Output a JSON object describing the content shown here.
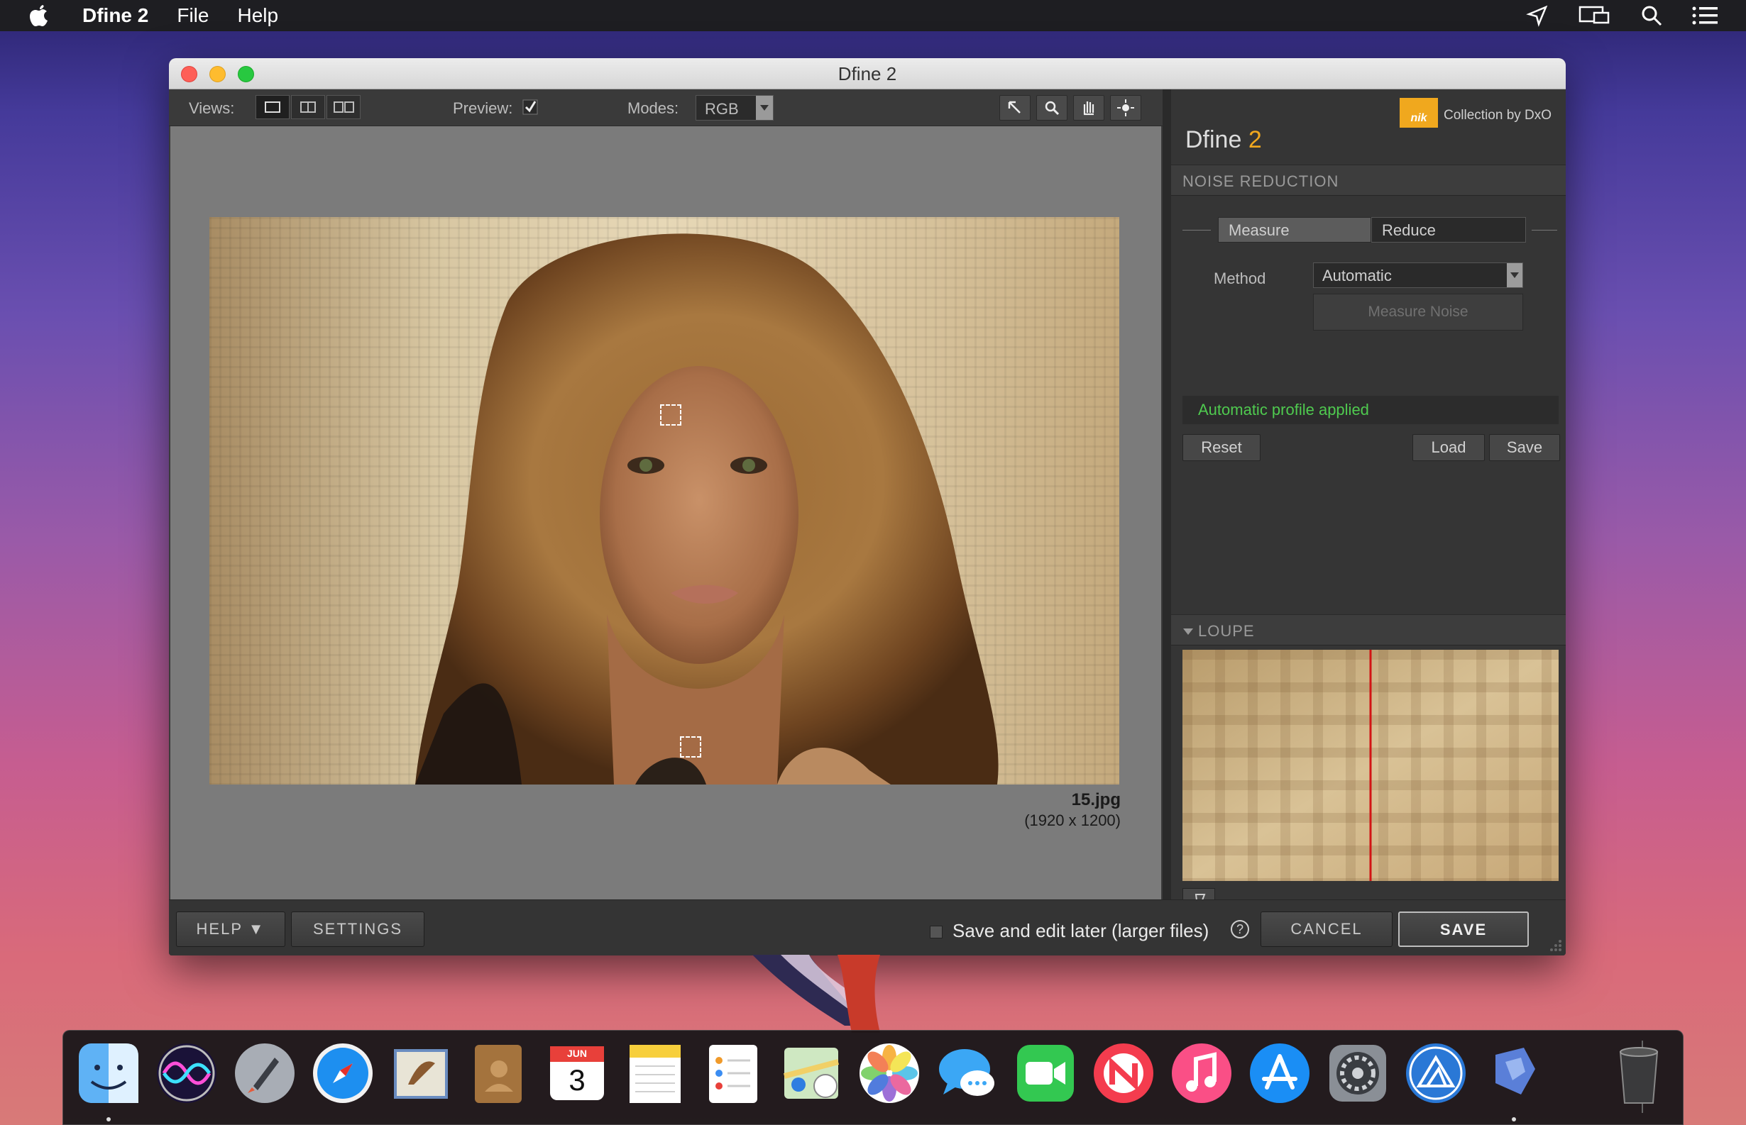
{
  "menubar": {
    "app_name": "Dfine 2",
    "items": [
      "File",
      "Help"
    ]
  },
  "window": {
    "title": "Dfine 2"
  },
  "toolbar": {
    "views_label": "Views:",
    "preview_label": "Preview:",
    "preview_checked": true,
    "modes_label": "Modes:",
    "mode_value": "RGB"
  },
  "image": {
    "file_name": "15.jpg",
    "dimensions": "(1920 x 1200)"
  },
  "panel": {
    "collection": "Collection by DxO",
    "logo_text": "nik",
    "title": "Dfine",
    "title_version": "2",
    "noise_section": "NOISE REDUCTION",
    "tabs": [
      "Measure",
      "Reduce"
    ],
    "method_label": "Method",
    "method_value": "Automatic",
    "measure_noise": "Measure Noise",
    "status": "Automatic profile applied",
    "reset": "Reset",
    "load": "Load",
    "save": "Save",
    "loupe_section": "LOUPE"
  },
  "bottombar": {
    "help": "HELP ▼",
    "settings": "SETTINGS",
    "save_later": "Save and edit later (larger files)",
    "cancel": "CANCEL",
    "save": "SAVE"
  },
  "dock": {
    "icons": [
      "finder-icon",
      "siri-icon",
      "launchpad-icon",
      "safari-icon",
      "mail-icon",
      "contacts-icon",
      "calendar-icon",
      "notes-icon",
      "reminders-icon",
      "maps-icon",
      "photos-icon",
      "messages-icon",
      "facetime-icon",
      "news-icon",
      "music-icon",
      "app-store-icon",
      "system-preferences-icon",
      "affinity-icon",
      "feedback-icon",
      "trash-icon"
    ],
    "calendar_month": "JUN",
    "calendar_day": "3"
  },
  "colors": {
    "accent_orange": "#f0a81e",
    "status_green": "#4fca4f",
    "loupe_line": "#d21414"
  }
}
